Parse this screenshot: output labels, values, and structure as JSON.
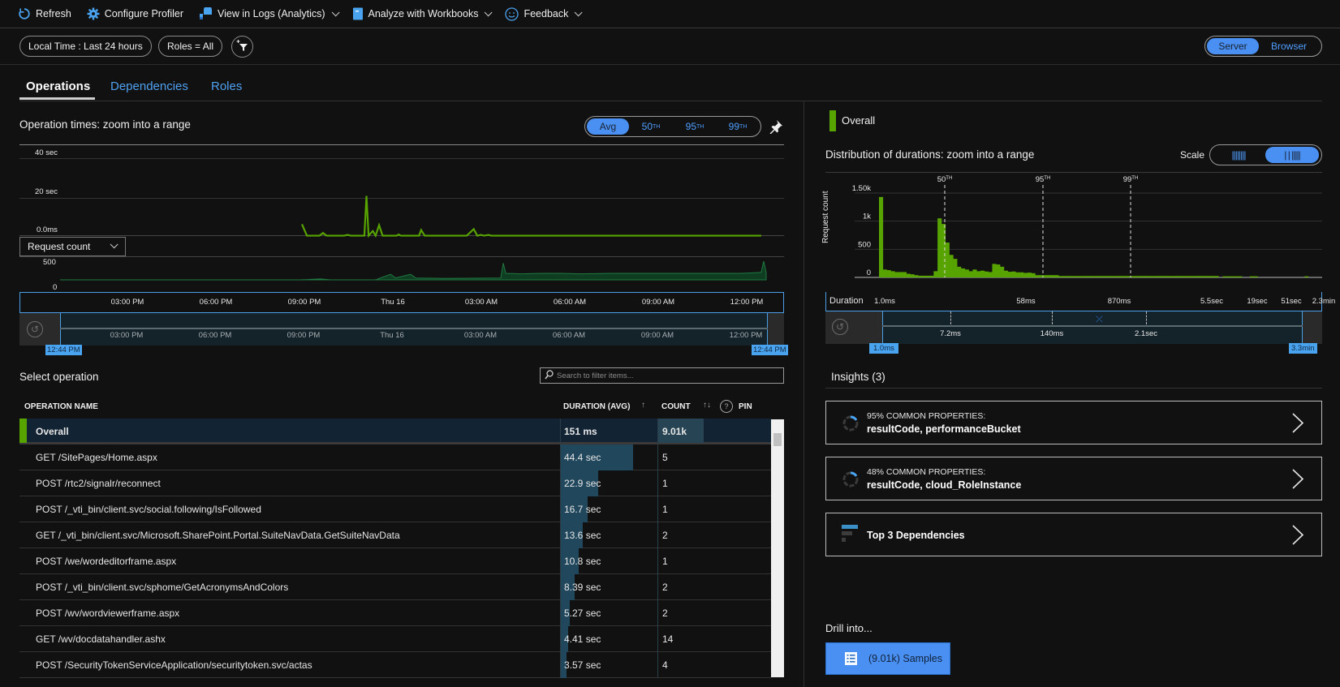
{
  "toolbar": {
    "refresh": "Refresh",
    "configure_profiler": "Configure Profiler",
    "view_in_logs": "View in Logs (Analytics)",
    "analyze_workbooks": "Analyze with Workbooks",
    "feedback": "Feedback"
  },
  "filters": {
    "time": "Local Time : Last 24 hours",
    "roles": "Roles = All"
  },
  "view_toggle": {
    "options": [
      "Server",
      "Browser"
    ],
    "selected": "Server"
  },
  "tabs": [
    {
      "label": "Operations",
      "active": true
    },
    {
      "label": "Dependencies",
      "active": false
    },
    {
      "label": "Roles",
      "active": false
    }
  ],
  "operation_times": {
    "title": "Operation times: zoom into a range",
    "aggregation": {
      "avg": "Avg",
      "p50": "50",
      "p95": "95",
      "p99": "99",
      "suffix": "TH",
      "selected": "Avg"
    },
    "y_labels": [
      "40 sec",
      "20 sec",
      "0.0ms"
    ],
    "metric_select": "Request count",
    "count_labels": [
      "500",
      "0"
    ],
    "x_ticks": [
      "03:00 PM",
      "06:00 PM",
      "09:00 PM",
      "Thu 16",
      "03:00 AM",
      "06:00 AM",
      "09:00 AM",
      "12:00 PM"
    ],
    "range_start": "12:44 PM",
    "range_end": "12:44 PM",
    "duration_series_sec": [
      0,
      0,
      0,
      0,
      0,
      0,
      0,
      0,
      0,
      0,
      0,
      0,
      0,
      0,
      0,
      0,
      0,
      0,
      0,
      0,
      0,
      0,
      0,
      0,
      0,
      0,
      0,
      0,
      0,
      0,
      0,
      0,
      0,
      0,
      0,
      0,
      0,
      0,
      0,
      0,
      0,
      0,
      0,
      0,
      0,
      0,
      0,
      0,
      0,
      0,
      0,
      0,
      0,
      0,
      0,
      0,
      0,
      0,
      0,
      0,
      0,
      0,
      0,
      0,
      0,
      0,
      0,
      0,
      0,
      0,
      0,
      0,
      0,
      0,
      0,
      0,
      0,
      0,
      0,
      0,
      0,
      0,
      0,
      0,
      0,
      0,
      0,
      0,
      0,
      0,
      0,
      0,
      0,
      0,
      0,
      0,
      0,
      0,
      0,
      0,
      0,
      0,
      0,
      0,
      0,
      0,
      0,
      0,
      0,
      0,
      0,
      0,
      0,
      0,
      0,
      0,
      0,
      0,
      0,
      0,
      0,
      0,
      0,
      0,
      0,
      0,
      0,
      0,
      0,
      0,
      0,
      0,
      0,
      0,
      0,
      0,
      0,
      0,
      0,
      0,
      0,
      0,
      0,
      0,
      0,
      0,
      0,
      0,
      0,
      0,
      0,
      0,
      0,
      0,
      0,
      0,
      0,
      0,
      0,
      0,
      0,
      0,
      0,
      0,
      0,
      0,
      0,
      0,
      0,
      0,
      0,
      0,
      0,
      0,
      0,
      0,
      0,
      0,
      0,
      0,
      0,
      0,
      0,
      0,
      0,
      0,
      0,
      0,
      0,
      0,
      0,
      0,
      0,
      0,
      0,
      0,
      0,
      0,
      0,
      0,
      0,
      0,
      0,
      0,
      0,
      0,
      0,
      0,
      0,
      0,
      0,
      0,
      0,
      0,
      0,
      0,
      0,
      0,
      0,
      0,
      0,
      0,
      0,
      0,
      0,
      0,
      0,
      0,
      0,
      0,
      0,
      0,
      0,
      0,
      0,
      0,
      0,
      0,
      0,
      0,
      0,
      0,
      0,
      0,
      0,
      0,
      0,
      0,
      0,
      0,
      0,
      0,
      0,
      0,
      0,
      0,
      0,
      0,
      0,
      0,
      0,
      0,
      0,
      0,
      0,
      0,
      0,
      0,
      0,
      0,
      0,
      0,
      0,
      0,
      0,
      0,
      0,
      0,
      0,
      0,
      0,
      0,
      0,
      0,
      0,
      0,
      0,
      0,
      0,
      0,
      0,
      0,
      0,
      0,
      0,
      0,
      0,
      0,
      0,
      0,
      0,
      0
    ],
    "duration_points": [
      [
        0.345,
        6.5
      ],
      [
        0.352,
        0.6
      ],
      [
        0.37,
        0.6
      ],
      [
        0.375,
        2
      ],
      [
        0.38,
        0.6
      ],
      [
        0.405,
        0.6
      ],
      [
        0.41,
        1
      ],
      [
        0.415,
        0.6
      ],
      [
        0.434,
        0.6
      ],
      [
        0.437,
        21
      ],
      [
        0.44,
        0.6
      ],
      [
        0.446,
        3
      ],
      [
        0.45,
        0.6
      ],
      [
        0.455,
        6
      ],
      [
        0.46,
        0.6
      ],
      [
        0.48,
        0.6
      ],
      [
        0.483,
        1.2
      ],
      [
        0.486,
        0.6
      ],
      [
        0.512,
        0.6
      ],
      [
        0.515,
        3.5
      ],
      [
        0.52,
        0.6
      ],
      [
        0.58,
        0.6
      ],
      [
        0.59,
        4
      ],
      [
        0.595,
        0.6
      ],
      [
        0.6,
        1
      ],
      [
        0.605,
        0.6
      ],
      [
        0.611,
        1
      ],
      [
        0.615,
        0.6
      ],
      [
        1.0,
        0.6
      ]
    ],
    "count_points": [
      [
        0.07,
        0
      ],
      [
        0.48,
        0
      ],
      [
        0.52,
        10
      ],
      [
        0.54,
        0
      ],
      [
        0.63,
        0
      ],
      [
        0.66,
        60
      ],
      [
        0.67,
        20
      ],
      [
        0.7,
        60
      ],
      [
        0.71,
        20
      ],
      [
        0.77,
        15
      ],
      [
        0.88,
        20
      ],
      [
        0.885,
        180
      ],
      [
        0.89,
        70
      ],
      [
        0.92,
        65
      ],
      [
        0.96,
        70
      ],
      [
        1.0,
        70
      ],
      [
        1.04,
        65
      ],
      [
        1.1,
        70
      ],
      [
        1.16,
        70
      ],
      [
        1.22,
        70
      ],
      [
        1.3,
        70
      ],
      [
        1.36,
        70
      ],
      [
        1.4,
        80
      ],
      [
        1.405,
        200
      ],
      [
        1.41,
        80
      ]
    ]
  },
  "distribution": {
    "legend": "Overall",
    "title": "Distribution of durations: zoom into a range",
    "scale_label": "Scale",
    "percentiles": [
      "50",
      "95",
      "99"
    ],
    "percentile_suffix": "TH",
    "y_axis_label": "Request count",
    "y_labels": [
      "1.50k",
      "1k",
      "500",
      "0"
    ],
    "duration_label": "Duration",
    "x_ticks": [
      "1.0ms",
      "58ms",
      "870ms",
      "5.5sec",
      "19sec",
      "51sec",
      "2.3min"
    ],
    "brush_ticks": [
      "7.2ms",
      "140ms",
      "2.1sec"
    ],
    "range_start": "1.0ms",
    "range_end": "3.3min"
  },
  "chart_data": {
    "type": "bar",
    "title": "Distribution of durations",
    "xlabel": "Duration",
    "ylabel": "Request count",
    "ylim": [
      0,
      1500
    ],
    "values": [
      1430,
      140,
      130,
      110,
      95,
      95,
      95,
      65,
      55,
      40,
      30,
      30,
      30,
      30,
      110,
      1050,
      950,
      620,
      400,
      330,
      190,
      160,
      140,
      110,
      140,
      110,
      120,
      105,
      95,
      240,
      230,
      190,
      120,
      100,
      105,
      90,
      90,
      80,
      85,
      75,
      40,
      40,
      40,
      40,
      40,
      40,
      25,
      25,
      25,
      25,
      25,
      25,
      25,
      25,
      25,
      25,
      25,
      25,
      25,
      25,
      25,
      25,
      25,
      25,
      25,
      25,
      25,
      25,
      25,
      25,
      25,
      25,
      25,
      25,
      25,
      25,
      25,
      25,
      25,
      25,
      25,
      25,
      25,
      25,
      25,
      25,
      25,
      0,
      20,
      20,
      20,
      20,
      20,
      0,
      0,
      20,
      20,
      0,
      0,
      0,
      0,
      0,
      0,
      0,
      0,
      0,
      0,
      0,
      0,
      20
    ]
  },
  "insights": {
    "title": "Insights (3)",
    "cards": [
      {
        "small": "95% COMMON PROPERTIES:",
        "big": "resultCode, performanceBucket"
      },
      {
        "small": "48% COMMON PROPERTIES:",
        "big": "resultCode, cloud_RoleInstance"
      },
      {
        "big": "Top 3 Dependencies"
      }
    ]
  },
  "drill": {
    "label": "Drill into...",
    "samples_button": "(9.01k) Samples"
  },
  "operations": {
    "title": "Select operation",
    "search_placeholder": "Search to filter items...",
    "columns": {
      "name": "OPERATION NAME",
      "duration": "DURATION (AVG)",
      "count": "COUNT",
      "pin": "PIN"
    },
    "rows": [
      {
        "name": "Overall",
        "duration": "151 ms",
        "count": "9.01k",
        "duration_frac": 0,
        "overall": true
      },
      {
        "name": "GET /SitePages/Home.aspx",
        "duration": "44.4 sec",
        "count": "5",
        "duration_frac": 1.0
      },
      {
        "name": "POST /rtc2/signalr/reconnect",
        "duration": "22.9 sec",
        "count": "1",
        "duration_frac": 0.516
      },
      {
        "name": "POST /_vti_bin/client.svc/social.following/IsFollowed",
        "duration": "16.7 sec",
        "count": "1",
        "duration_frac": 0.376
      },
      {
        "name": "GET /_vti_bin/client.svc/Microsoft.SharePoint.Portal.SuiteNavData.GetSuiteNavData",
        "duration": "13.6 sec",
        "count": "2",
        "duration_frac": 0.306
      },
      {
        "name": "POST /we/wordeditorframe.aspx",
        "duration": "10.8 sec",
        "count": "1",
        "duration_frac": 0.243
      },
      {
        "name": "POST /_vti_bin/client.svc/sphome/GetAcronymsAndColors",
        "duration": "8.39 sec",
        "count": "2",
        "duration_frac": 0.189
      },
      {
        "name": "POST /wv/wordviewerframe.aspx",
        "duration": "5.27 sec",
        "count": "2",
        "duration_frac": 0.119
      },
      {
        "name": "GET /wv/docdatahandler.ashx",
        "duration": "4.41 sec",
        "count": "14",
        "duration_frac": 0.099
      },
      {
        "name": "POST /SecurityTokenServiceApplication/securitytoken.svc/actas",
        "duration": "3.57 sec",
        "count": "4",
        "duration_frac": 0.08
      }
    ]
  },
  "colors": {
    "accent": "#4a90f2",
    "series_green": "#57a300",
    "count_green": "#1f6b3a",
    "link_blue": "#4fa0f0",
    "bar_fill": "#21475d"
  }
}
